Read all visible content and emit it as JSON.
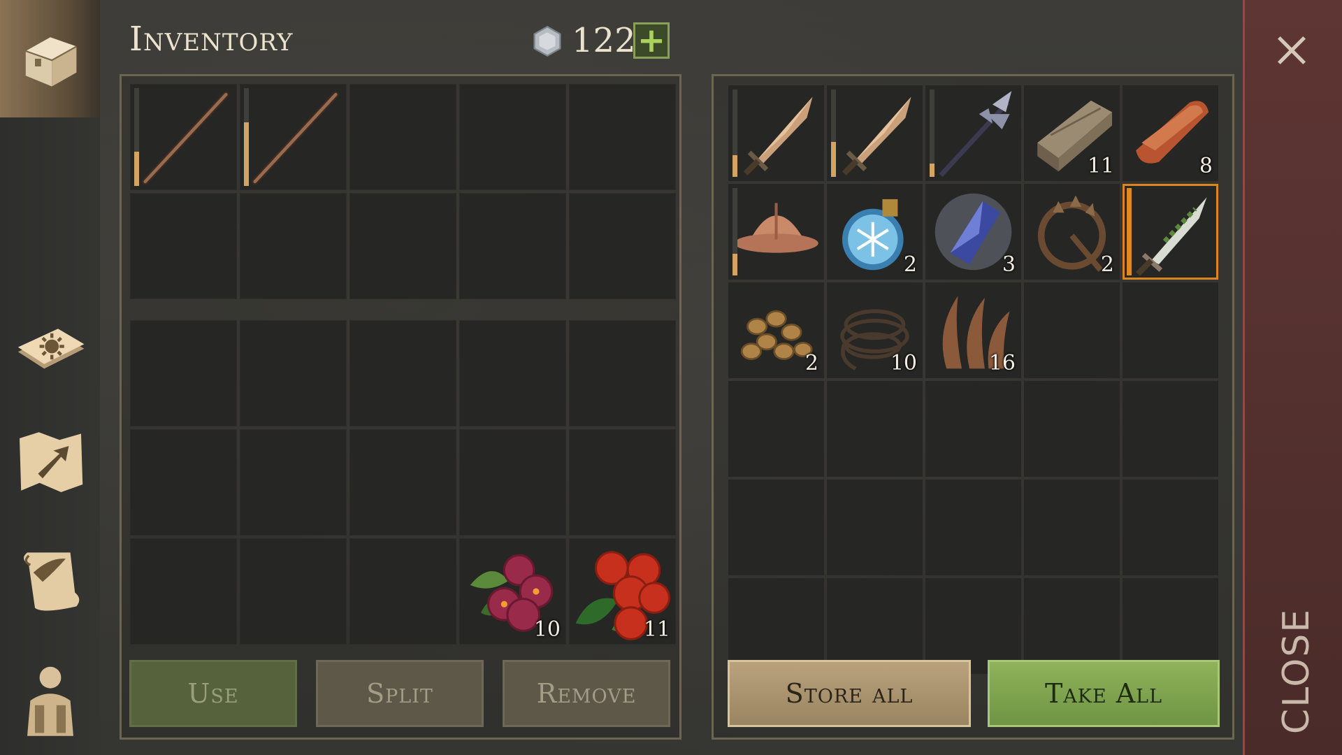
{
  "header": {
    "title": "Inventory",
    "coins": "122",
    "add_label": "+"
  },
  "nav": {
    "items": [
      {
        "icon": "chest-icon",
        "active": true
      },
      {
        "icon": "crafting-book-icon"
      },
      {
        "icon": "map-icon"
      },
      {
        "icon": "quest-scroll-icon"
      },
      {
        "icon": "character-equipment-icon"
      }
    ]
  },
  "inventory": {
    "slots": [
      {
        "item": "wooden-staff",
        "durability": 0.35
      },
      {
        "item": "wooden-staff",
        "durability": 0.65
      },
      {},
      {},
      {},
      {},
      {},
      {},
      {},
      {},
      {},
      {},
      {},
      {},
      {},
      {},
      {},
      {},
      {},
      {},
      {},
      {},
      {},
      {
        "item": "purple-berries",
        "qty": "10"
      },
      {
        "item": "red-berries",
        "qty": "11"
      }
    ],
    "buttons": {
      "use": "Use",
      "split": "Split",
      "remove": "Remove"
    }
  },
  "storage": {
    "slots": [
      {
        "item": "iron-sword",
        "durability": 0.25
      },
      {
        "item": "iron-sword",
        "durability": 0.4
      },
      {
        "item": "halberd",
        "durability": 0.15
      },
      {
        "item": "wood-planks",
        "qty": "11"
      },
      {
        "item": "copper-ingot",
        "qty": "8"
      },
      {
        "item": "iron-helmet",
        "durability": 0.25
      },
      {
        "item": "frost-potion",
        "qty": "2"
      },
      {
        "item": "blue-crystal",
        "qty": "3"
      },
      {
        "item": "bear-trap",
        "qty": "2"
      },
      {
        "item": "poisoned-dagger",
        "durability": 1.0,
        "selected": true
      },
      {
        "item": "nuts",
        "qty": "2"
      },
      {
        "item": "rope",
        "qty": "10"
      },
      {
        "item": "dried-leaves",
        "qty": "16"
      },
      {},
      {},
      {},
      {},
      {},
      {},
      {},
      {},
      {},
      {},
      {},
      {},
      {},
      {},
      {},
      {},
      {}
    ],
    "buttons": {
      "store_all": "Store all",
      "take_all": "Take All"
    }
  },
  "close": {
    "label": "CLOSE"
  }
}
